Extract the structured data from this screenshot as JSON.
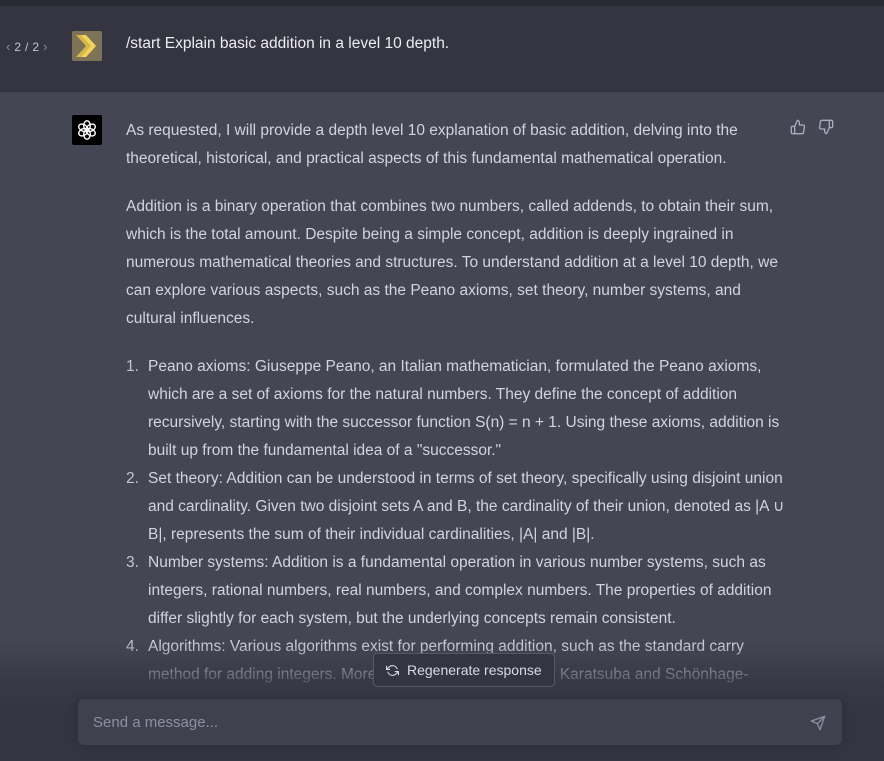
{
  "topbar": {},
  "user_message": {
    "pager": {
      "current": "2",
      "separator": "/",
      "total": "2"
    },
    "text": "/start Explain basic addition in a level 10 depth."
  },
  "assistant": {
    "paragraphs": [
      "As requested, I will provide a depth level 10 explanation of basic addition, delving into the theoretical, historical, and practical aspects of this fundamental mathematical operation.",
      "Addition is a binary operation that combines two numbers, called addends, to obtain their sum, which is the total amount. Despite being a simple concept, addition is deeply ingrained in numerous mathematical theories and structures. To understand addition at a level 10 depth, we can explore various aspects, such as the Peano axioms, set theory, number systems, and cultural influences."
    ],
    "list": [
      {
        "num": "1.",
        "text": "Peano axioms: Giuseppe Peano, an Italian mathematician, formulated the Peano axioms, which are a set of axioms for the natural numbers. They define the concept of addition recursively, starting with the successor function S(n) = n + 1. Using these axioms, addition is built up from the fundamental idea of a \"successor.\""
      },
      {
        "num": "2.",
        "text": "Set theory: Addition can be understood in terms of set theory, specifically using disjoint union and cardinality. Given two disjoint sets A and B, the cardinality of their union, denoted as |A ∪ B|, represents the sum of their individual cardinalities, |A| and |B|."
      },
      {
        "num": "3.",
        "text": "Number systems: Addition is a fundamental operation in various number systems, such as integers, rational numbers, real numbers, and complex numbers. The properties of addition differ slightly for each system, but the underlying concepts remain consistent."
      },
      {
        "num": "4.",
        "text": "Algorithms: Various algorithms exist for performing addition, such as the standard carry method for adding integers. More advanced algorithms, like Karatsuba and Schönhage-"
      }
    ],
    "icons": {
      "avatar": "openai-logo-icon",
      "like": "thumbs-up-icon",
      "dislike": "thumbs-down-icon"
    }
  },
  "regenerate": {
    "label": "Regenerate response",
    "icon": "refresh-icon"
  },
  "composer": {
    "placeholder": "Send a message...",
    "value": "",
    "send_icon": "send-icon"
  },
  "colors": {
    "user_bg": "#343541",
    "assistant_bg": "#444654",
    "text": "#d1d5db",
    "input_bg": "#40414f"
  }
}
